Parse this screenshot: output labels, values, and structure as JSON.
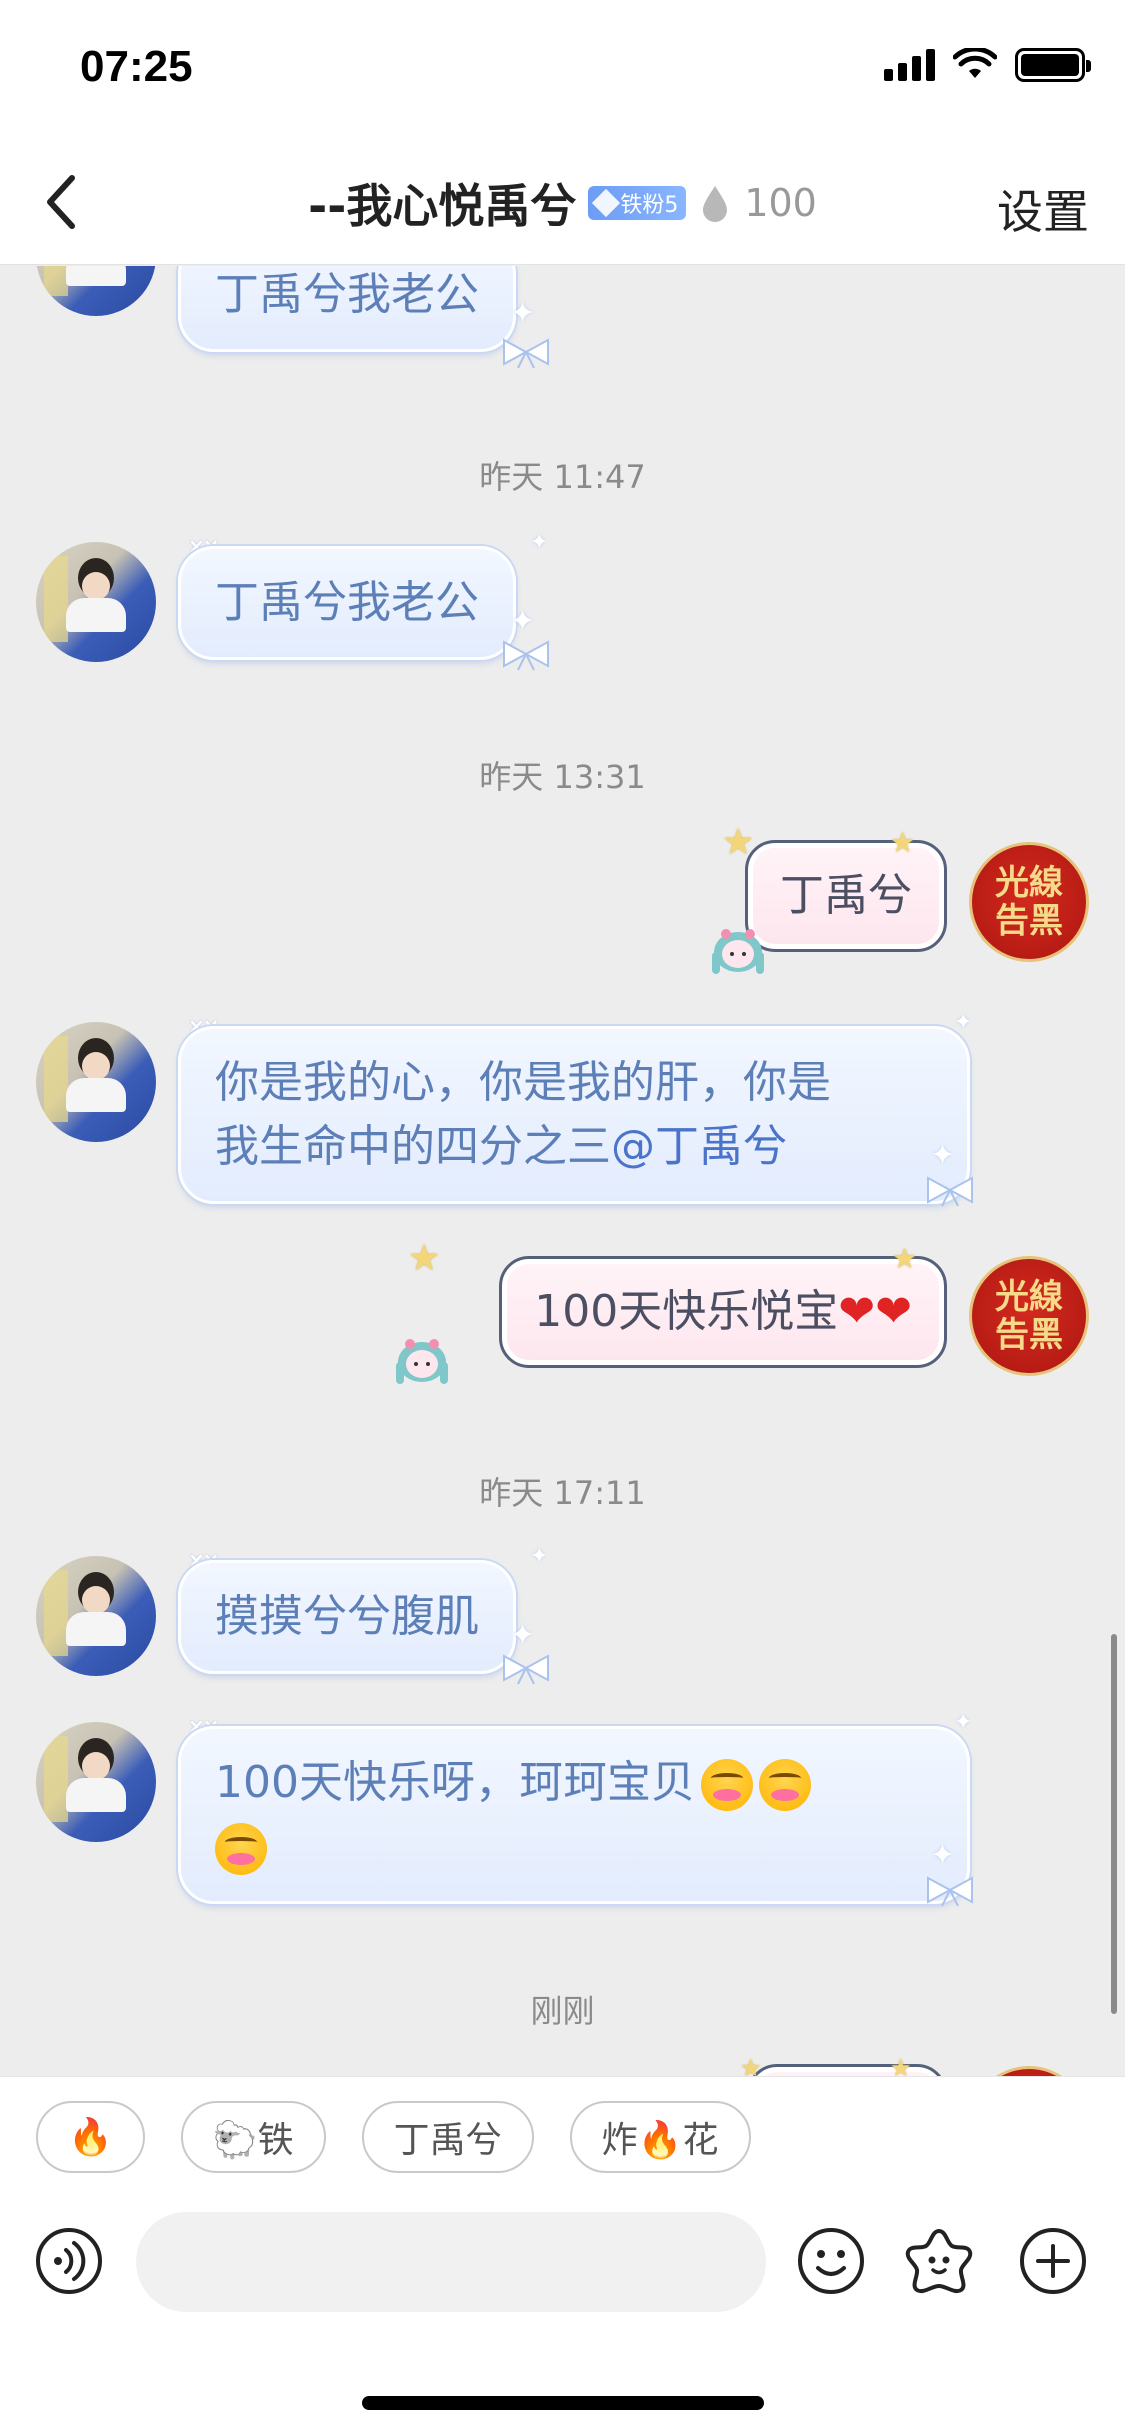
{
  "status_bar": {
    "time": "07:25"
  },
  "header": {
    "title": "--我心悦禹兮",
    "fan_badge": "铁粉5",
    "heat_value": "100",
    "settings_label": "设置"
  },
  "messages": {
    "m0": {
      "text": "丁禹兮我老公"
    },
    "t1": "昨天 11:47",
    "m1": {
      "text": "丁禹兮我老公"
    },
    "t2": "昨天 13:31",
    "m2": {
      "text": "丁禹兮"
    },
    "m3": {
      "line1": "你是我的心，你是我的肝，你是",
      "line2_prefix": "我生命中的四分之三",
      "mention": "@丁禹兮"
    },
    "m4": {
      "text": "100天快乐悦宝",
      "hearts": "❤❤"
    },
    "t3": "昨天 17:11",
    "m5": {
      "text": "摸摸兮兮腹肌"
    },
    "m6": {
      "text": "100天快乐呀，珂珂宝贝"
    },
    "t4": "刚刚"
  },
  "right_avatar": {
    "line1": "光線",
    "line2": "告黑"
  },
  "quick_phrases": [
    {
      "label": "🔥"
    },
    {
      "label": "🐑铁"
    },
    {
      "label": "丁禹兮"
    },
    {
      "label": "炸🔥花"
    }
  ],
  "input": {
    "placeholder": ""
  },
  "colors": {
    "bubble_left_text": "#5d7fb8",
    "bubble_right_text": "#4b4f61",
    "fan_badge": "#6c9cf4",
    "mention": "#4a73c9"
  },
  "icons": {
    "back": "chevron-left-icon",
    "heat": "drop-icon",
    "voice": "voice-icon",
    "emoji": "smile-icon",
    "sticker": "star-flower-icon",
    "more": "plus-circle-icon"
  }
}
